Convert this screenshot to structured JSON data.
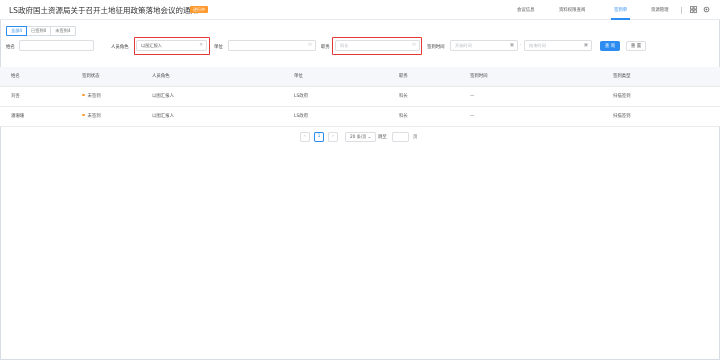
{
  "header": {
    "title": "LS政府国土资源局关于召开土地征用政策落地会议的通知",
    "badge": "进行中",
    "nav": [
      {
        "label": "会议信息",
        "active": false
      },
      {
        "label": "资料权限查阅",
        "active": false
      },
      {
        "label": "签到单",
        "active": true
      },
      {
        "label": "资源管理",
        "active": false
      }
    ],
    "icons": [
      "grid-icon",
      "gear-icon"
    ]
  },
  "tabs": [
    {
      "label": "全部4",
      "active": true
    },
    {
      "label": "已签到0",
      "active": false
    },
    {
      "label": "未签到4",
      "active": false
    }
  ],
  "filters": {
    "name": {
      "label": "姓名",
      "value": ""
    },
    "role": {
      "label": "人员角色",
      "placeholder": "以图汇报人"
    },
    "unit": {
      "label": "单位",
      "placeholder": ""
    },
    "position": {
      "label": "职务",
      "placeholder": "科长"
    },
    "signin_time": {
      "label": "签到时间",
      "start_placeholder": "开始时间",
      "end_placeholder": "结束时间",
      "separator": "-"
    },
    "query_button": "查 询",
    "reset_button": "重 置"
  },
  "table": {
    "columns": [
      "姓名",
      "签到状态",
      "人员角色",
      "单位",
      "职务",
      "签到时间",
      "签到类型"
    ],
    "rows": [
      {
        "name": "刘杏",
        "status": "未签到",
        "status_color": "#ff9a2e",
        "role": "以图汇报人",
        "unit": "LS政府",
        "position": "科长",
        "time": "—",
        "type": "扫描签到"
      },
      {
        "name": "潘珊珊",
        "status": "未签到",
        "status_color": "#ff9a2e",
        "role": "以图汇报人",
        "unit": "LS政府",
        "position": "科长",
        "time": "—",
        "type": "扫描签到"
      }
    ]
  },
  "pagination": {
    "prev": "‹",
    "current_page": "1",
    "next": "›",
    "page_size": "20 条/页",
    "goto_label": "跳至",
    "page_unit": "页"
  },
  "colors": {
    "accent": "#2d8cf0",
    "warning": "#ff9a2e",
    "highlight_box": "#e53935"
  }
}
